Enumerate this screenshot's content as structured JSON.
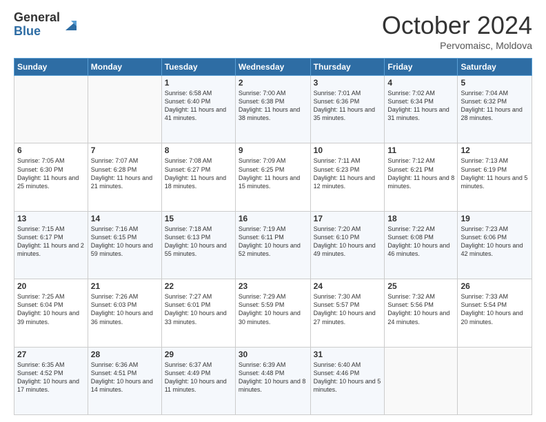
{
  "logo": {
    "general": "General",
    "blue": "Blue"
  },
  "header": {
    "month": "October 2024",
    "location": "Pervomaisc, Moldova"
  },
  "weekdays": [
    "Sunday",
    "Monday",
    "Tuesday",
    "Wednesday",
    "Thursday",
    "Friday",
    "Saturday"
  ],
  "weeks": [
    [
      {
        "day": "",
        "info": ""
      },
      {
        "day": "",
        "info": ""
      },
      {
        "day": "1",
        "info": "Sunrise: 6:58 AM\nSunset: 6:40 PM\nDaylight: 11 hours and 41 minutes."
      },
      {
        "day": "2",
        "info": "Sunrise: 7:00 AM\nSunset: 6:38 PM\nDaylight: 11 hours and 38 minutes."
      },
      {
        "day": "3",
        "info": "Sunrise: 7:01 AM\nSunset: 6:36 PM\nDaylight: 11 hours and 35 minutes."
      },
      {
        "day": "4",
        "info": "Sunrise: 7:02 AM\nSunset: 6:34 PM\nDaylight: 11 hours and 31 minutes."
      },
      {
        "day": "5",
        "info": "Sunrise: 7:04 AM\nSunset: 6:32 PM\nDaylight: 11 hours and 28 minutes."
      }
    ],
    [
      {
        "day": "6",
        "info": "Sunrise: 7:05 AM\nSunset: 6:30 PM\nDaylight: 11 hours and 25 minutes."
      },
      {
        "day": "7",
        "info": "Sunrise: 7:07 AM\nSunset: 6:28 PM\nDaylight: 11 hours and 21 minutes."
      },
      {
        "day": "8",
        "info": "Sunrise: 7:08 AM\nSunset: 6:27 PM\nDaylight: 11 hours and 18 minutes."
      },
      {
        "day": "9",
        "info": "Sunrise: 7:09 AM\nSunset: 6:25 PM\nDaylight: 11 hours and 15 minutes."
      },
      {
        "day": "10",
        "info": "Sunrise: 7:11 AM\nSunset: 6:23 PM\nDaylight: 11 hours and 12 minutes."
      },
      {
        "day": "11",
        "info": "Sunrise: 7:12 AM\nSunset: 6:21 PM\nDaylight: 11 hours and 8 minutes."
      },
      {
        "day": "12",
        "info": "Sunrise: 7:13 AM\nSunset: 6:19 PM\nDaylight: 11 hours and 5 minutes."
      }
    ],
    [
      {
        "day": "13",
        "info": "Sunrise: 7:15 AM\nSunset: 6:17 PM\nDaylight: 11 hours and 2 minutes."
      },
      {
        "day": "14",
        "info": "Sunrise: 7:16 AM\nSunset: 6:15 PM\nDaylight: 10 hours and 59 minutes."
      },
      {
        "day": "15",
        "info": "Sunrise: 7:18 AM\nSunset: 6:13 PM\nDaylight: 10 hours and 55 minutes."
      },
      {
        "day": "16",
        "info": "Sunrise: 7:19 AM\nSunset: 6:11 PM\nDaylight: 10 hours and 52 minutes."
      },
      {
        "day": "17",
        "info": "Sunrise: 7:20 AM\nSunset: 6:10 PM\nDaylight: 10 hours and 49 minutes."
      },
      {
        "day": "18",
        "info": "Sunrise: 7:22 AM\nSunset: 6:08 PM\nDaylight: 10 hours and 46 minutes."
      },
      {
        "day": "19",
        "info": "Sunrise: 7:23 AM\nSunset: 6:06 PM\nDaylight: 10 hours and 42 minutes."
      }
    ],
    [
      {
        "day": "20",
        "info": "Sunrise: 7:25 AM\nSunset: 6:04 PM\nDaylight: 10 hours and 39 minutes."
      },
      {
        "day": "21",
        "info": "Sunrise: 7:26 AM\nSunset: 6:03 PM\nDaylight: 10 hours and 36 minutes."
      },
      {
        "day": "22",
        "info": "Sunrise: 7:27 AM\nSunset: 6:01 PM\nDaylight: 10 hours and 33 minutes."
      },
      {
        "day": "23",
        "info": "Sunrise: 7:29 AM\nSunset: 5:59 PM\nDaylight: 10 hours and 30 minutes."
      },
      {
        "day": "24",
        "info": "Sunrise: 7:30 AM\nSunset: 5:57 PM\nDaylight: 10 hours and 27 minutes."
      },
      {
        "day": "25",
        "info": "Sunrise: 7:32 AM\nSunset: 5:56 PM\nDaylight: 10 hours and 24 minutes."
      },
      {
        "day": "26",
        "info": "Sunrise: 7:33 AM\nSunset: 5:54 PM\nDaylight: 10 hours and 20 minutes."
      }
    ],
    [
      {
        "day": "27",
        "info": "Sunrise: 6:35 AM\nSunset: 4:52 PM\nDaylight: 10 hours and 17 minutes."
      },
      {
        "day": "28",
        "info": "Sunrise: 6:36 AM\nSunset: 4:51 PM\nDaylight: 10 hours and 14 minutes."
      },
      {
        "day": "29",
        "info": "Sunrise: 6:37 AM\nSunset: 4:49 PM\nDaylight: 10 hours and 11 minutes."
      },
      {
        "day": "30",
        "info": "Sunrise: 6:39 AM\nSunset: 4:48 PM\nDaylight: 10 hours and 8 minutes."
      },
      {
        "day": "31",
        "info": "Sunrise: 6:40 AM\nSunset: 4:46 PM\nDaylight: 10 hours and 5 minutes."
      },
      {
        "day": "",
        "info": ""
      },
      {
        "day": "",
        "info": ""
      }
    ]
  ]
}
